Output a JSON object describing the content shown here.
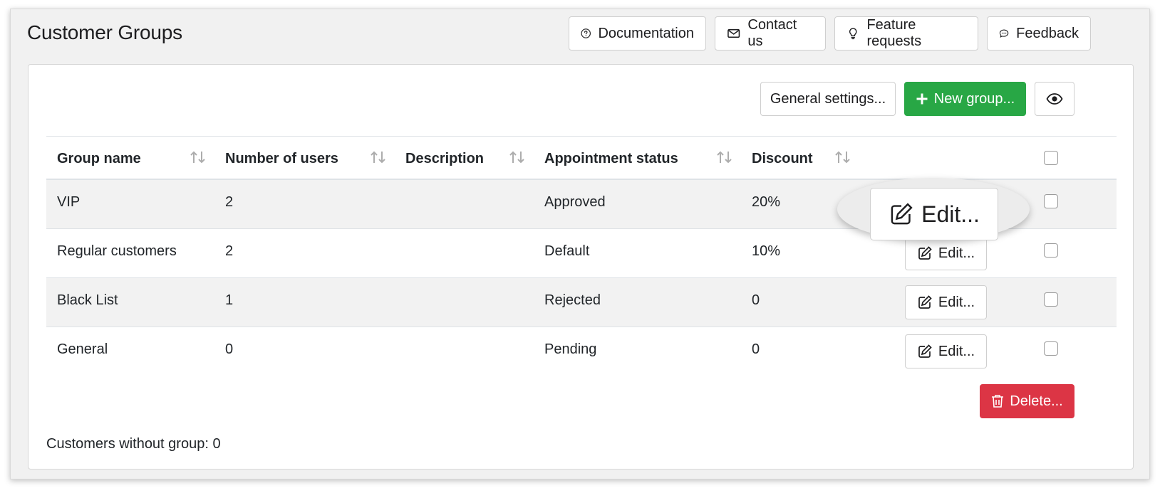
{
  "header": {
    "title": "Customer Groups",
    "buttons": {
      "documentation": "Documentation",
      "contact": "Contact us",
      "feature": "Feature requests",
      "feedback": "Feedback"
    }
  },
  "toolbar": {
    "general_settings": "General settings...",
    "new_group": "New group...",
    "preview_icon": "eye-icon"
  },
  "table": {
    "columns": [
      "Group name",
      "Number of users",
      "Description",
      "Appointment status",
      "Discount"
    ],
    "rows": [
      {
        "name": "VIP",
        "users": "2",
        "description": "",
        "status": "Approved",
        "discount": "20%",
        "edit": "Edit..."
      },
      {
        "name": "Regular customers",
        "users": "2",
        "description": "",
        "status": "Default",
        "discount": "10%",
        "edit": "Edit..."
      },
      {
        "name": "Black List",
        "users": "1",
        "description": "",
        "status": "Rejected",
        "discount": "0",
        "edit": "Edit..."
      },
      {
        "name": "General",
        "users": "0",
        "description": "",
        "status": "Pending",
        "discount": "0",
        "edit": "Edit..."
      }
    ]
  },
  "delete_button": "Delete...",
  "footer": {
    "customers_without_group": "Customers without group: 0"
  },
  "callout": {
    "label": "Edit..."
  },
  "colors": {
    "green": "#28a745",
    "red": "#dc3545",
    "stripe": "#f2f2f2"
  }
}
